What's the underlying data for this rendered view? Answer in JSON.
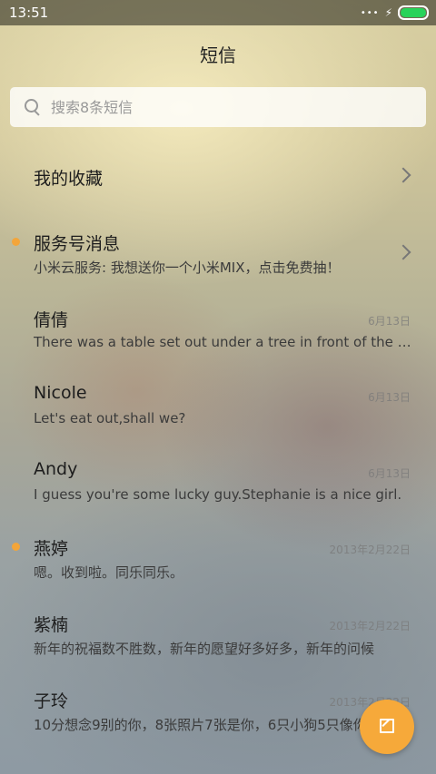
{
  "status_bar": {
    "time": "13:51",
    "indicators": "•••",
    "charging_icon": "⚡"
  },
  "header": {
    "title": "短信"
  },
  "search": {
    "placeholder": "搜索8条短信",
    "icon": "search-icon"
  },
  "favorites": {
    "label": "我的收藏"
  },
  "conversations": [
    {
      "name": "服务号消息",
      "snippet": "小米云服务: 我想送你一个小米MIX，点击免费抽！",
      "date": "",
      "unread": true,
      "chevron": true
    },
    {
      "name": "倩倩",
      "snippet": "There was a table set out under a tree in front of the house",
      "date": "6月13日",
      "unread": false
    },
    {
      "name": "Nicole",
      "snippet": "Let's eat out,shall we?",
      "date": "6月13日",
      "unread": false
    },
    {
      "name": "Andy",
      "snippet": "I guess you're some lucky guy.Stephanie is a nice girl.",
      "date": "6月13日",
      "unread": false
    },
    {
      "name": "燕婷",
      "snippet": "嗯。收到啦。同乐同乐。",
      "date": "2013年2月22日",
      "unread": true
    },
    {
      "name": "紫楠",
      "snippet": "新年的祝福数不胜数，新年的愿望好多好多，新年的问候",
      "date": "2013年2月22日",
      "unread": false
    },
    {
      "name": "子玲",
      "snippet": "10分想念9别的你，8张照片7张是你，6只小狗5只像你",
      "date": "2013年2月22日",
      "unread": false
    }
  ],
  "colors": {
    "accent": "#f6a93a",
    "battery": "#27d35a"
  },
  "fab": {
    "icon": "compose-icon"
  }
}
